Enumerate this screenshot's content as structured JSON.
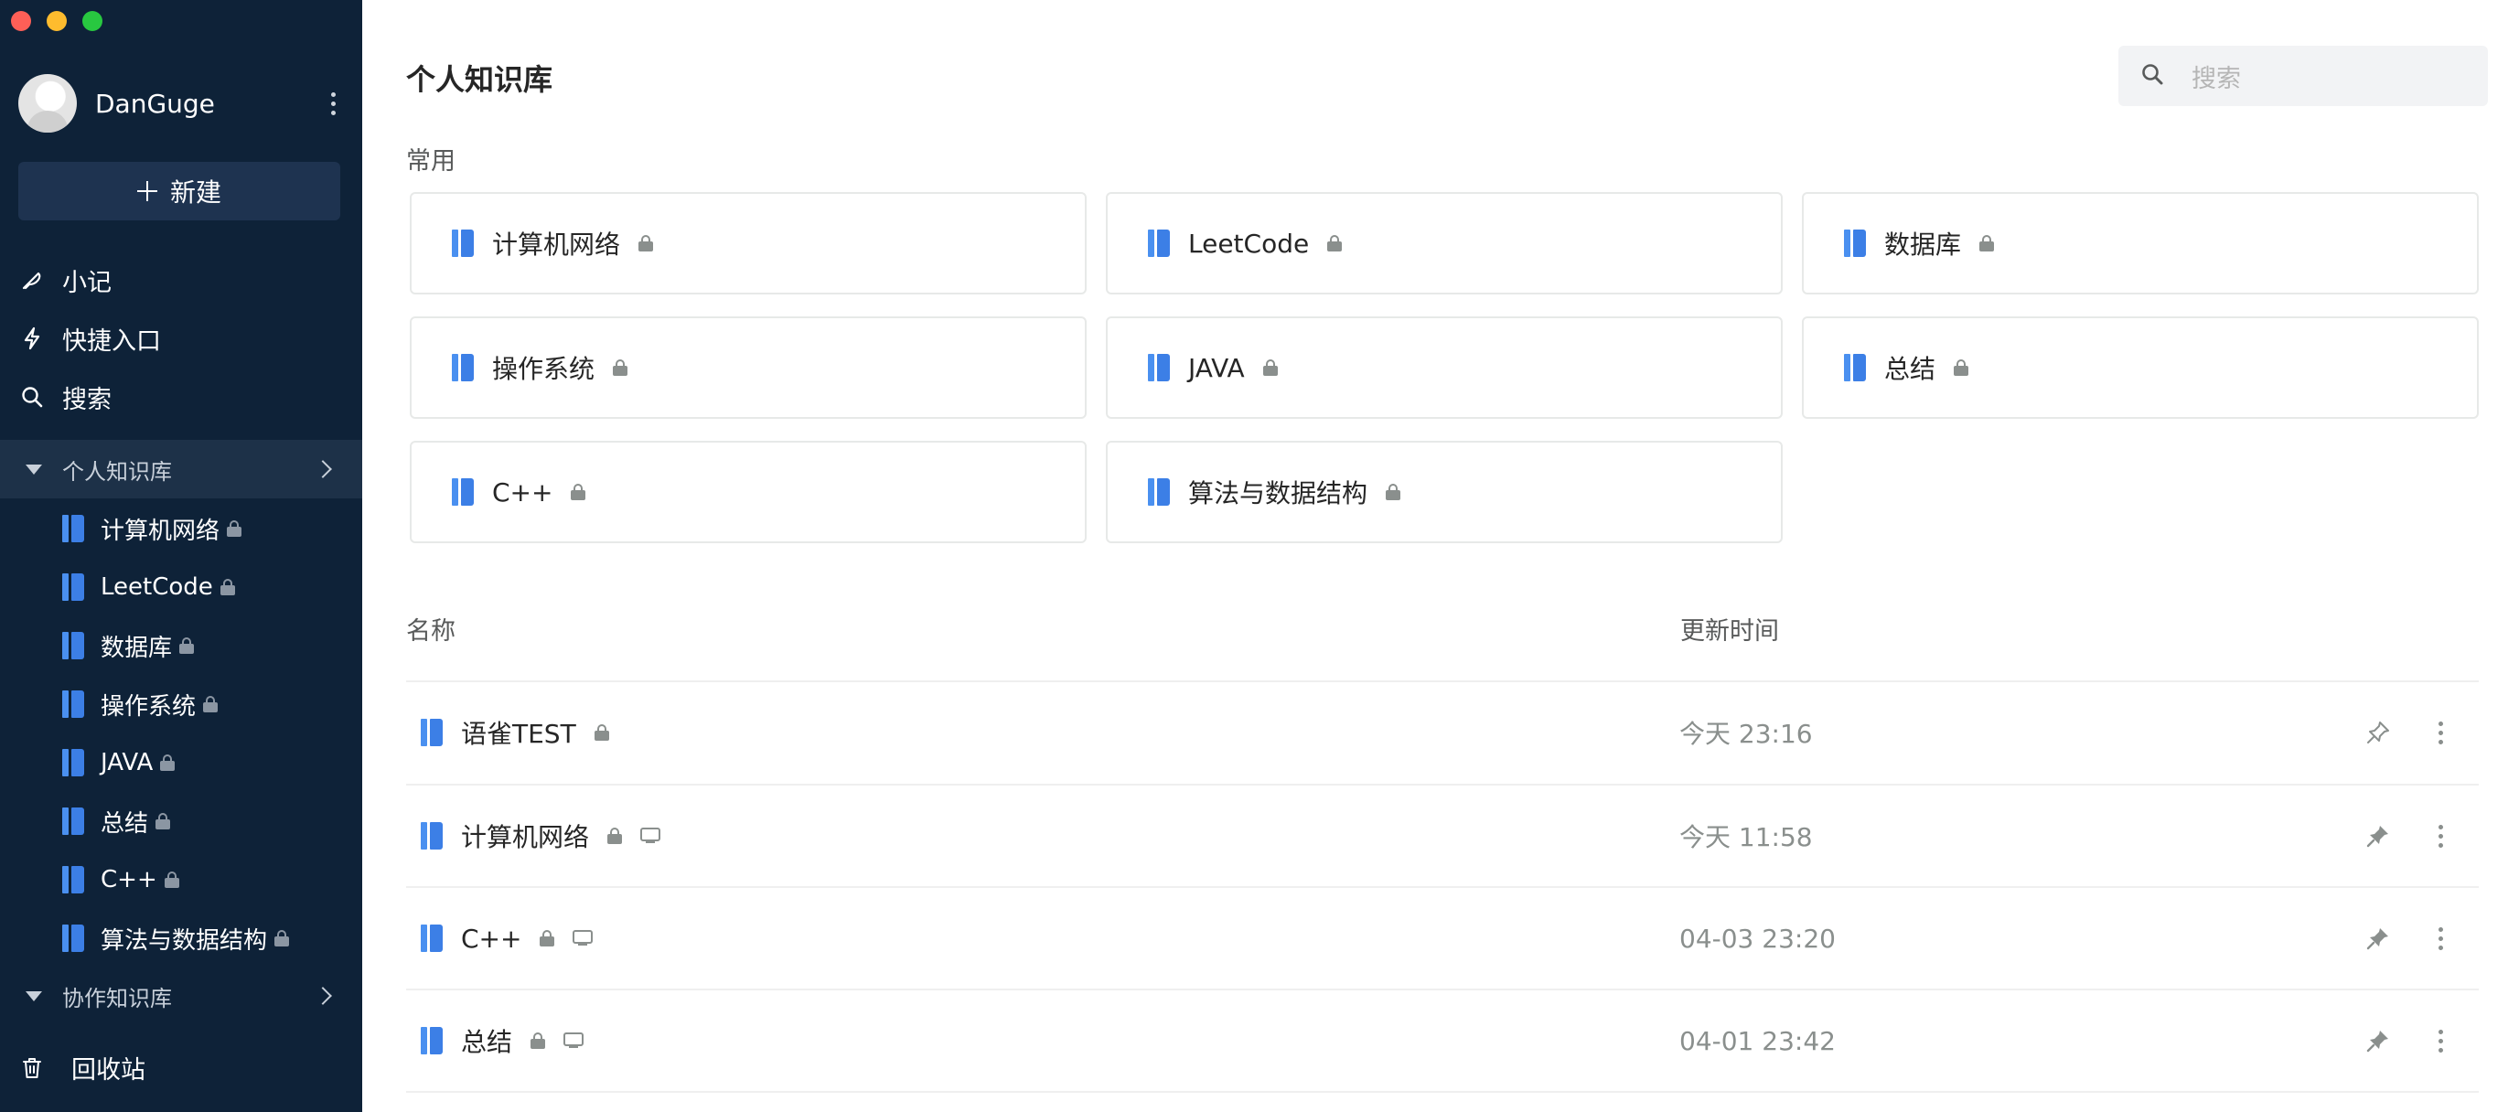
{
  "user": {
    "name": "DanGuge"
  },
  "sidebar": {
    "new_label": "新建",
    "nav": [
      {
        "label": "小记",
        "icon": "feather-icon"
      },
      {
        "label": "快捷入口",
        "icon": "lightning-icon"
      },
      {
        "label": "搜索",
        "icon": "search-icon"
      }
    ],
    "personal_group": "个人知识库",
    "items": [
      {
        "label": "计算机网络"
      },
      {
        "label": "LeetCode"
      },
      {
        "label": "数据库"
      },
      {
        "label": "操作系统"
      },
      {
        "label": "JAVA"
      },
      {
        "label": "总结"
      },
      {
        "label": "C++"
      },
      {
        "label": "算法与数据结构"
      }
    ],
    "collab_group": "协作知识库",
    "trash_label": "回收站"
  },
  "main": {
    "title": "个人知识库",
    "search_placeholder": "搜索",
    "common_label": "常用",
    "cards": [
      {
        "label": "计算机网络"
      },
      {
        "label": "LeetCode"
      },
      {
        "label": "数据库"
      },
      {
        "label": "操作系统"
      },
      {
        "label": "JAVA"
      },
      {
        "label": "总结"
      },
      {
        "label": "C++"
      },
      {
        "label": "算法与数据结构"
      }
    ],
    "columns": {
      "name": "名称",
      "updated": "更新时间"
    },
    "rows": [
      {
        "name": "语雀TEST",
        "time": "今天 23:16",
        "pinned": false,
        "shared": false
      },
      {
        "name": "计算机网络",
        "time": "今天 11:58",
        "pinned": true,
        "shared": true
      },
      {
        "name": "C++",
        "time": "04-03 23:20",
        "pinned": true,
        "shared": true
      },
      {
        "name": "总结",
        "time": "04-01 23:42",
        "pinned": true,
        "shared": true
      }
    ]
  },
  "colors": {
    "sidebar_bg": "#0e2238",
    "book_icon": "#4a90f0",
    "traffic": [
      "#fe5f57",
      "#febc2e",
      "#28c840"
    ]
  }
}
